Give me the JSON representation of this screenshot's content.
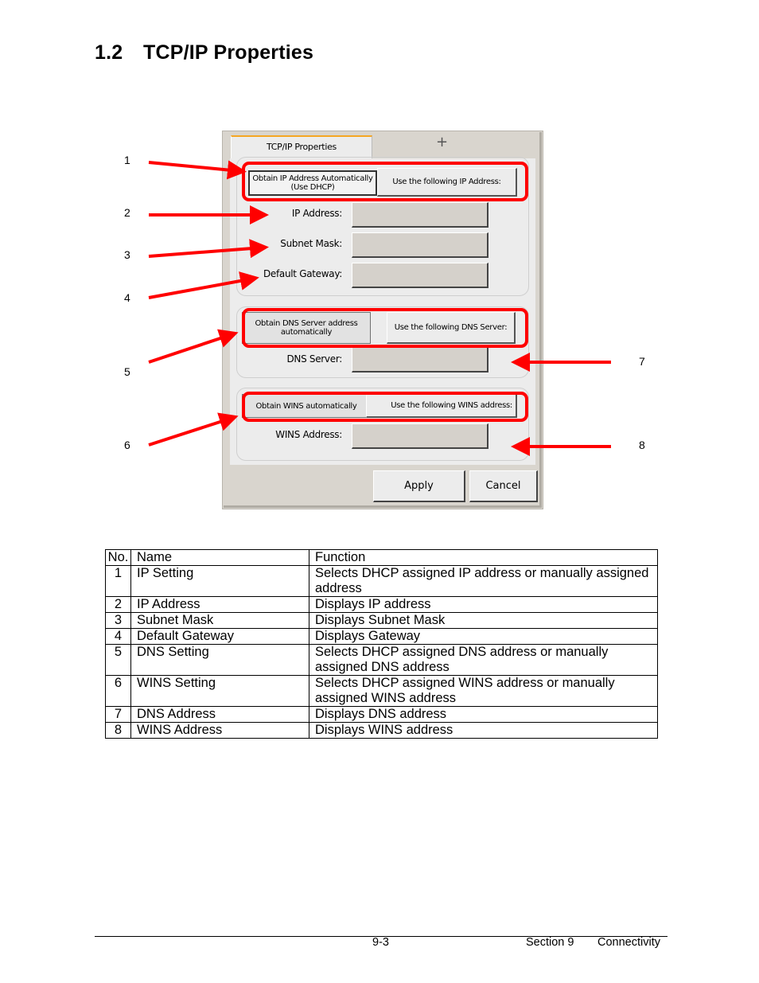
{
  "heading": {
    "number": "1.2",
    "title": "TCP/IP Properties"
  },
  "screenshot": {
    "tab_label": "TCP/IP Properties",
    "ip_group": {
      "auto_option": "Obtain IP Address Automatically (Use DHCP)",
      "manual_option": "Use the following IP Address:",
      "selected": "auto",
      "fields": [
        {
          "label": "IP Address:",
          "value": ""
        },
        {
          "label": "Subnet Mask:",
          "value": ""
        },
        {
          "label": "Default Gateway:",
          "value": ""
        }
      ]
    },
    "dns_group": {
      "auto_option": "Obtain DNS Server address automatically",
      "manual_option": "Use the following DNS Server:",
      "field_label": "DNS Server:",
      "field_value": ""
    },
    "wins_group": {
      "auto_option": "Obtain WINS automatically",
      "manual_option": "Use the following WINS address:",
      "field_label": "WINS Address:",
      "field_value": ""
    },
    "apply_label": "Apply",
    "cancel_label": "Cancel",
    "highlight_color": "#ff0000"
  },
  "callouts": [
    "1",
    "2",
    "3",
    "4",
    "5",
    "6",
    "7",
    "8"
  ],
  "table": {
    "headers": [
      "No.",
      "Name",
      "Function"
    ],
    "rows": [
      {
        "no": "1",
        "name": "IP Setting",
        "function": "Selects DHCP assigned IP address or manually assigned address"
      },
      {
        "no": "2",
        "name": "IP Address",
        "function": "Displays IP address"
      },
      {
        "no": "3",
        "name": "Subnet Mask",
        "function": "Displays Subnet Mask"
      },
      {
        "no": "4",
        "name": "Default Gateway",
        "function": "Displays Gateway"
      },
      {
        "no": "5",
        "name": "DNS Setting",
        "function": "Selects DHCP assigned DNS address or manually assigned DNS address"
      },
      {
        "no": "6",
        "name": "WINS Setting",
        "function": "Selects DHCP assigned WINS address or manually assigned WINS address"
      },
      {
        "no": "7",
        "name": "DNS Address",
        "function": "Displays DNS address"
      },
      {
        "no": "8",
        "name": "WINS Address",
        "function": "Displays WINS address"
      }
    ]
  },
  "footer": {
    "page": "9-3",
    "section": "Section 9",
    "chapter": "Connectivity"
  }
}
